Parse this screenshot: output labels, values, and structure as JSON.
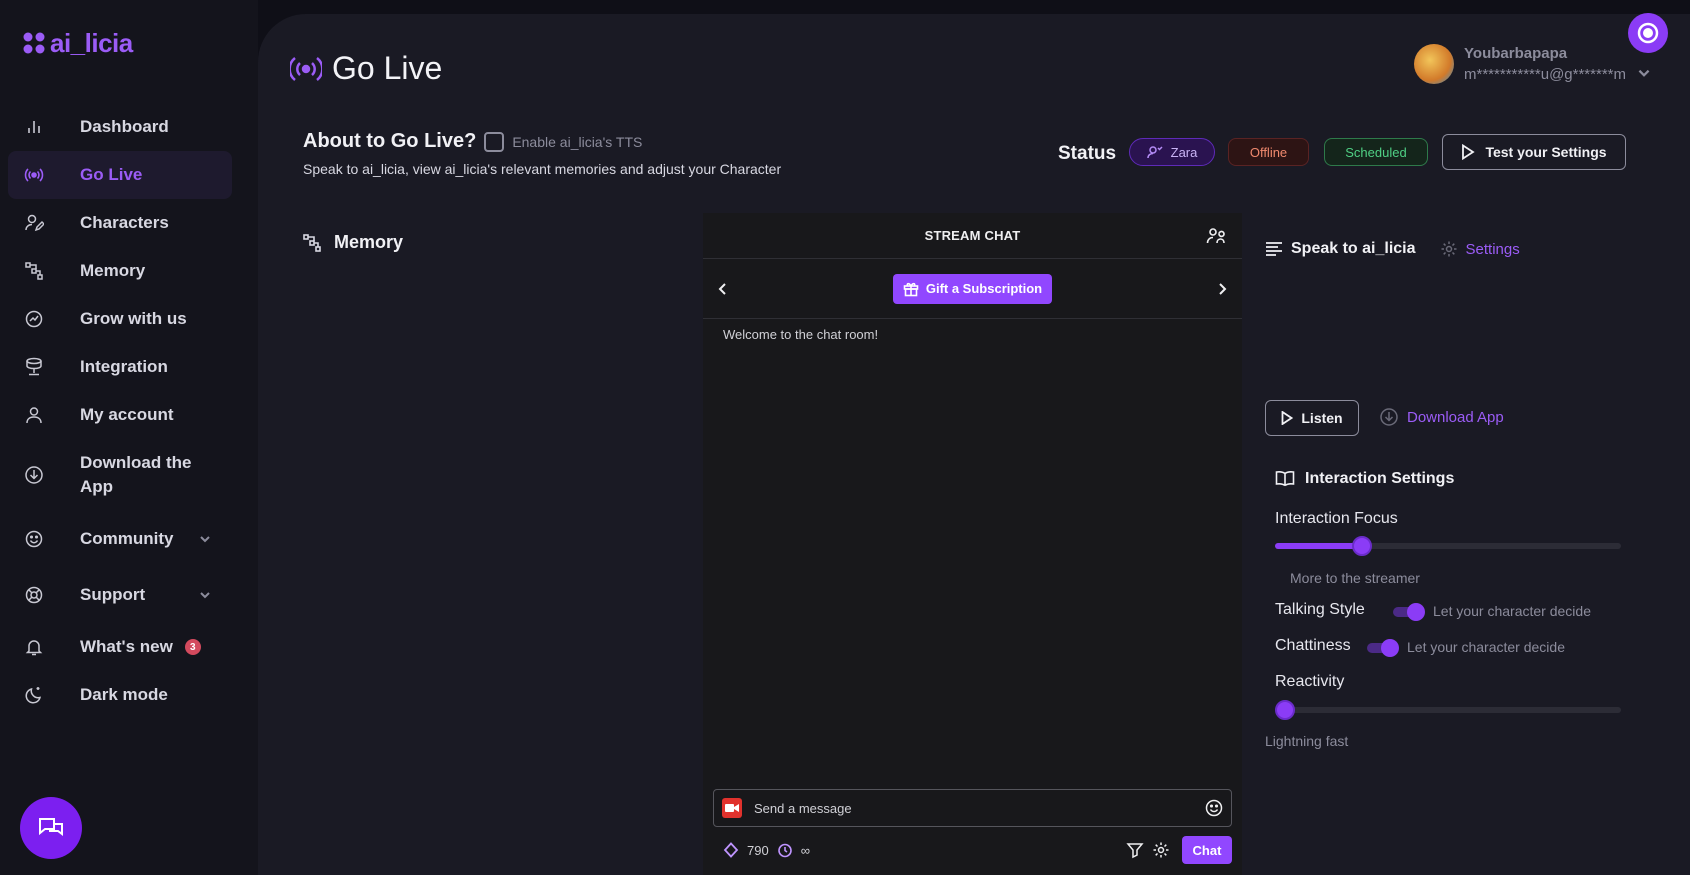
{
  "app": {
    "logo_text": "ai_licia"
  },
  "sidebar": {
    "items": [
      {
        "label": "Dashboard",
        "icon": "bar-chart-icon"
      },
      {
        "label": "Go Live",
        "icon": "broadcast-icon",
        "active": true
      },
      {
        "label": "Characters",
        "icon": "user-edit-icon"
      },
      {
        "label": "Memory",
        "icon": "memory-icon"
      },
      {
        "label": "Grow with us",
        "icon": "growth-icon"
      },
      {
        "label": "Integration",
        "icon": "database-icon"
      },
      {
        "label": "My account",
        "icon": "user-icon"
      },
      {
        "label": "Download the App",
        "icon": "download-icon"
      },
      {
        "label": "Community",
        "icon": "smile-icon"
      },
      {
        "label": "Support",
        "icon": "lifebuoy-icon"
      },
      {
        "label": "What's new",
        "icon": "bell-icon",
        "badge": "3"
      },
      {
        "label": "Dark mode",
        "icon": "moon-icon"
      }
    ]
  },
  "header": {
    "title": "Go Live",
    "user": {
      "name": "Youbarbapapa",
      "email": "m***********u@g*******m"
    }
  },
  "about": {
    "title": "About to Go Live?",
    "tts_label": "Enable ai_licia's TTS",
    "description": "Speak to ai_licia, view ai_licia's relevant memories and adjust your Character"
  },
  "status": {
    "label": "Status",
    "character": "Zara",
    "stream_state": "Offline",
    "schedule_state": "Scheduled",
    "test_button": "Test your Settings"
  },
  "memory": {
    "title": "Memory"
  },
  "stream_chat": {
    "title": "STREAM CHAT",
    "gift_button": "Gift a Subscription",
    "welcome": "Welcome to the chat room!",
    "input_placeholder": "Send a message",
    "points": "790",
    "infinity": "∞",
    "chat_button": "Chat"
  },
  "speak": {
    "title": "Speak to ai_licia",
    "settings_link": "Settings",
    "listen_button": "Listen",
    "download_link": "Download App"
  },
  "interaction": {
    "title": "Interaction Settings",
    "focus_label": "Interaction Focus",
    "focus_value": 0.25,
    "focus_hint": "More to the streamer",
    "talking_style_label": "Talking Style",
    "talking_style_hint": "Let your character decide",
    "chattiness_label": "Chattiness",
    "chattiness_hint": "Let your character decide",
    "reactivity_label": "Reactivity",
    "reactivity_value": 0,
    "reactivity_hint": "Lightning fast"
  },
  "colors": {
    "accent": "#9b5cf6",
    "twitch": "#9147ff"
  }
}
